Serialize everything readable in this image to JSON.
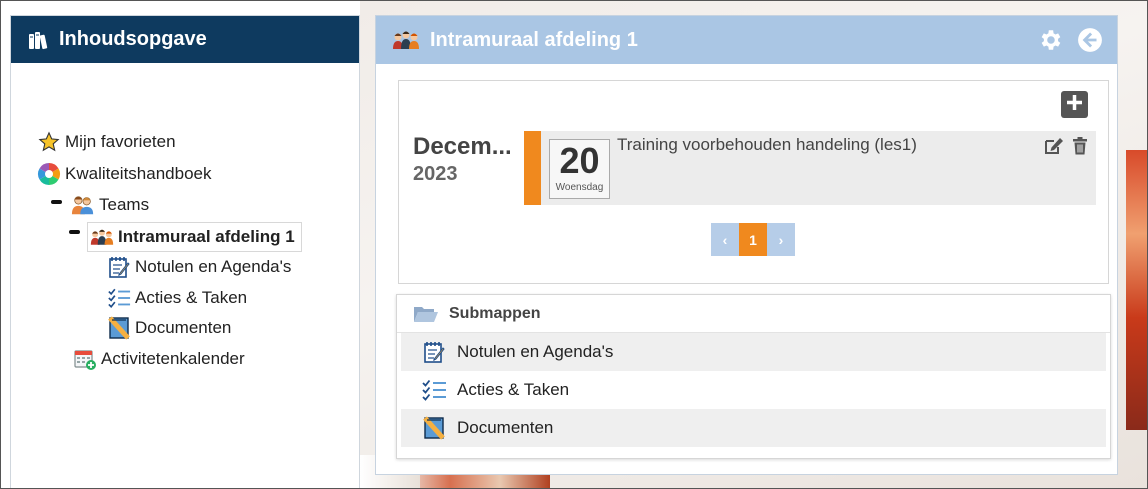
{
  "sidebar": {
    "title": "Inhoudsopgave",
    "items": [
      {
        "label": "Mijn favorieten",
        "icon": "star-icon"
      },
      {
        "label": "Kwaliteitshandboek",
        "icon": "colorwheel-icon"
      },
      {
        "label": "Teams",
        "icon": "team-icon"
      },
      {
        "label": "Intramuraal afdeling 1",
        "icon": "group-icon"
      },
      {
        "label": "Notulen en Agenda's",
        "icon": "notepad-icon"
      },
      {
        "label": "Acties & Taken",
        "icon": "checklist-icon"
      },
      {
        "label": "Documenten",
        "icon": "document-icon"
      },
      {
        "label": "Activitetenkalender",
        "icon": "calendar-add-icon"
      }
    ]
  },
  "main": {
    "title": "Intramuraal afdeling 1",
    "agenda": {
      "month": "Decem...",
      "year": "2023",
      "event": {
        "day": "20",
        "weekday": "Woensdag",
        "title": "Training voorbehouden handeling (les1)"
      },
      "pagination": {
        "prev": "‹",
        "current": "1",
        "next": "›"
      }
    },
    "submappen": {
      "title": "Submappen",
      "items": [
        {
          "label": "Notulen en Agenda's"
        },
        {
          "label": "Acties & Taken"
        },
        {
          "label": "Documenten"
        }
      ]
    }
  },
  "colors": {
    "sidebar_header": "#0e3a5f",
    "main_header": "#aac6e4",
    "accent_orange": "#f0891e",
    "pager_blue": "#b6cde8"
  }
}
